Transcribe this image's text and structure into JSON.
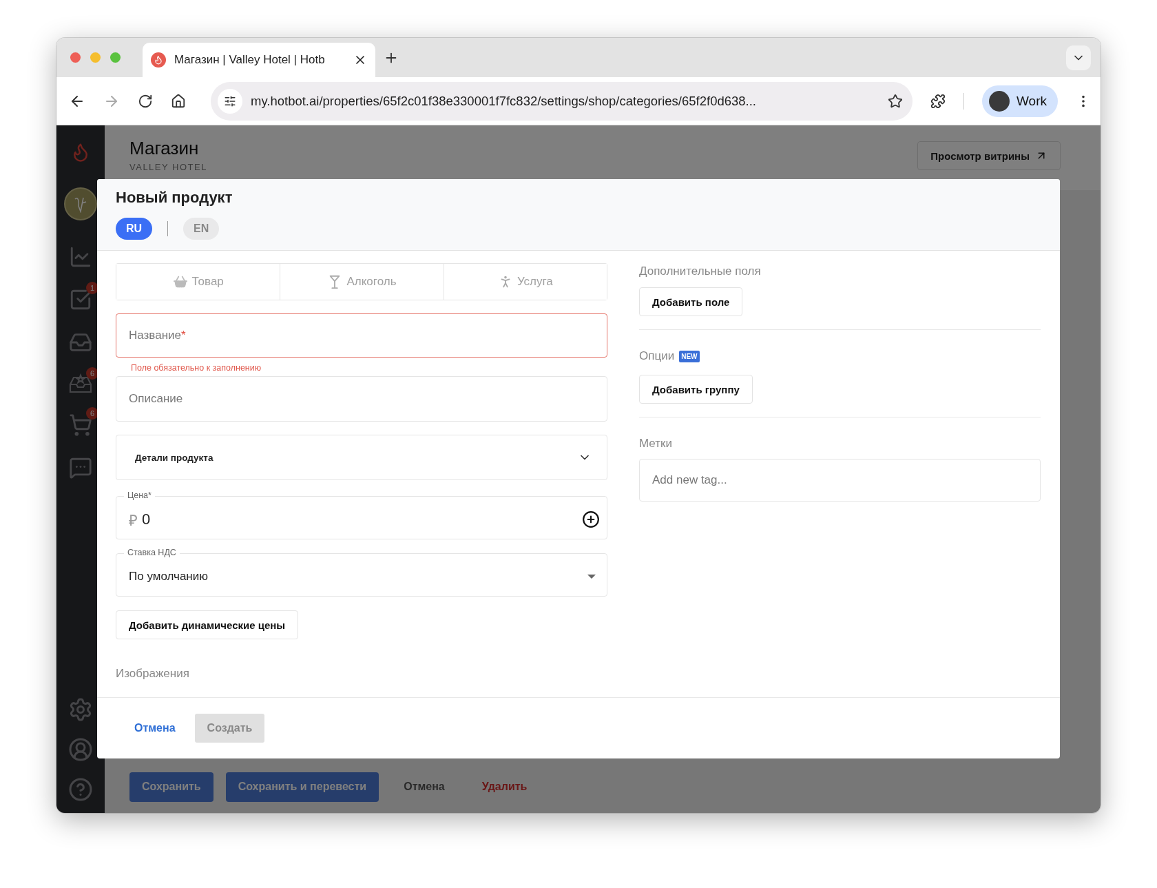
{
  "browser": {
    "tab": {
      "title": "Магазин | Valley Hotel | Hotb"
    },
    "address": {
      "url": "my.hotbot.ai/properties/65f2c01f38e330001f7fc832/settings/shop/categories/65f2f0d638..."
    },
    "profile": {
      "label": "Work"
    }
  },
  "sidebar": {
    "task_badge": "1",
    "reviews_badge": "6",
    "cart_badge": "6"
  },
  "page": {
    "title": "Магазин",
    "subtitle": "VALLEY HOTEL",
    "storefront_button": "Просмотр витрины",
    "actions": [
      {
        "label": "Сохранить",
        "kind": "primary"
      },
      {
        "label": "Сохранить и перевести",
        "kind": "primary"
      },
      {
        "label": "Отмена",
        "kind": "plain"
      },
      {
        "label": "Удалить",
        "kind": "danger"
      }
    ]
  },
  "modal": {
    "title": "Новый продукт",
    "languages": [
      {
        "label": "RU",
        "selected": true
      },
      {
        "label": "EN",
        "selected": false
      }
    ],
    "type_tabs": [
      {
        "label": "Товар",
        "kind": "basket",
        "selected": false
      },
      {
        "label": "Алкоголь",
        "kind": "glass",
        "selected": false
      },
      {
        "label": "Услуга",
        "kind": "person",
        "selected": false
      }
    ],
    "name_field": {
      "label": "Название",
      "required_mark": "*",
      "error": "Поле обязательно к заполнению"
    },
    "description_field": {
      "placeholder": "Описание"
    },
    "details": {
      "label": "Детали продукта",
      "expanded": false
    },
    "price": {
      "label": "Цена*",
      "currency": "₽",
      "value": "0"
    },
    "vat": {
      "label": "Ставка НДС",
      "value": "По умолчанию"
    },
    "dynamic_prices_button": "Добавить динамические цены",
    "images_label": "Изображения",
    "extra_fields": {
      "title": "Дополнительные поля",
      "button": "Добавить поле"
    },
    "options": {
      "title": "Опции",
      "badge": "NEW",
      "button": "Добавить группу"
    },
    "tags": {
      "title": "Метки",
      "placeholder": "Add new tag..."
    },
    "footer": {
      "cancel": "Отмена",
      "create": {
        "label": "Создать",
        "disabled": true
      }
    }
  }
}
